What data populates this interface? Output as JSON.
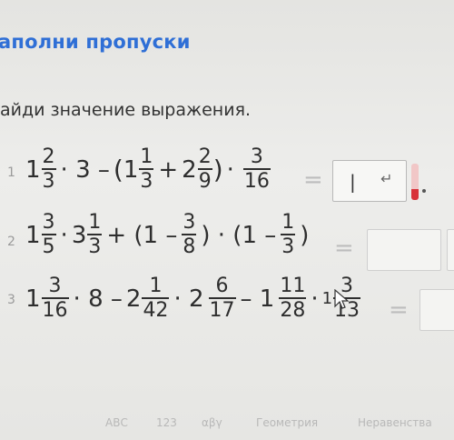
{
  "header": {
    "title": "аполни пропуски"
  },
  "instruction": "айди значение выражения.",
  "tasks": [
    {
      "num": "1"
    },
    {
      "num": "2"
    },
    {
      "num": "3"
    }
  ],
  "t1": {
    "w1": "1",
    "n1": "2",
    "d1": "3",
    "m1": "· 3 –",
    "lp": "(",
    "w2": "1",
    "n2": "1",
    "d2": "3",
    "plus": "+",
    "w3": "2",
    "n3": "2",
    "d3": "9",
    "rp": ")",
    "m2": "·",
    "n4": "3",
    "d4": "16",
    "eq": "="
  },
  "t2": {
    "w1": "1",
    "n1": "3",
    "d1": "5",
    "m1": "·",
    "w2": "3",
    "n2": "1",
    "d2": "3",
    "p1": "+ (1 –",
    "n3": "3",
    "d3": "8",
    "p2": ") · (1 –",
    "n4": "1",
    "d4": "3",
    "p3": ")",
    "eq": "="
  },
  "t3": {
    "w1": "1",
    "n1": "3",
    "d1": "16",
    "m1": "· 8 –",
    "w2": "2",
    "n2": "1",
    "d2": "42",
    "m2": "· 2",
    "n3": "6",
    "d3": "17",
    "m3": "– 1",
    "n4": "11",
    "d4": "28",
    "m4": "·",
    "w5": "1",
    "n5": "3",
    "d5": "13",
    "eq": "="
  },
  "answer1": {
    "value": "|",
    "enter_symbol": "↵"
  },
  "keyboard_tabs": [
    "АВС",
    "123",
    "αβγ",
    "Геометрия",
    "Неравенства"
  ],
  "colors": {
    "accent": "#2f6fd6",
    "error": "#d8323a"
  }
}
